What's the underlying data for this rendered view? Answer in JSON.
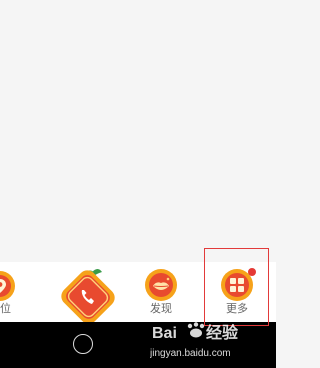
{
  "tabbar": {
    "tabs": [
      {
        "label": "定位",
        "icon": "location-pin-icon"
      },
      {
        "label": "",
        "icon": "phone-call-icon"
      },
      {
        "label": "发现",
        "icon": "discover-lips-icon"
      },
      {
        "label": "更多",
        "icon": "more-grid-icon",
        "badge": true
      }
    ]
  },
  "watermark": {
    "brand": "Bai",
    "brand_suffix": "经验",
    "url": "jingyan.baidu.com"
  },
  "colors": {
    "accent_orange": "#f6a21a",
    "accent_red": "#e84a2f",
    "highlight": "#e23a3a"
  }
}
